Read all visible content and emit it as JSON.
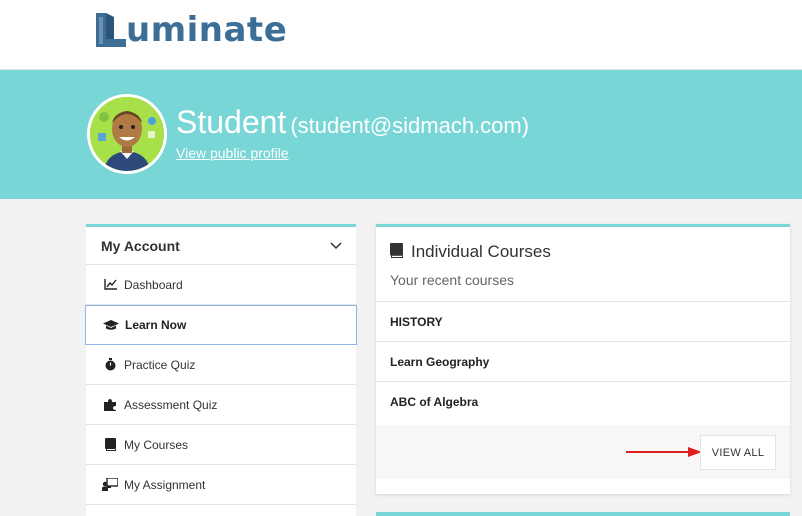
{
  "header": {
    "logo_text": "uminate",
    "logo_full": "Luminate"
  },
  "profile": {
    "name": "Student",
    "email": "(student@sidmach.com)",
    "public_profile_link": "View public profile"
  },
  "sidebar": {
    "title": "My Account",
    "items": [
      {
        "label": "Dashboard",
        "icon": "chart-line-icon"
      },
      {
        "label": "Learn Now",
        "icon": "graduation-cap-icon",
        "active": true
      },
      {
        "label": "Practice Quiz",
        "icon": "stopwatch-icon"
      },
      {
        "label": "Assessment Quiz",
        "icon": "puzzle-icon"
      },
      {
        "label": "My Courses",
        "icon": "book-icon"
      },
      {
        "label": "My Assignment",
        "icon": "chalkboard-teacher-icon"
      }
    ]
  },
  "courses_card": {
    "title": "Individual Courses",
    "subtitle": "Your recent courses",
    "courses": [
      "HISTORY",
      "Learn Geography",
      "ABC of Algebra"
    ],
    "view_all_label": "VIEW ALL"
  },
  "colors": {
    "accent": "#79d6d6",
    "brand": "#3d6e96",
    "annotation_arrow": "#e02020"
  }
}
